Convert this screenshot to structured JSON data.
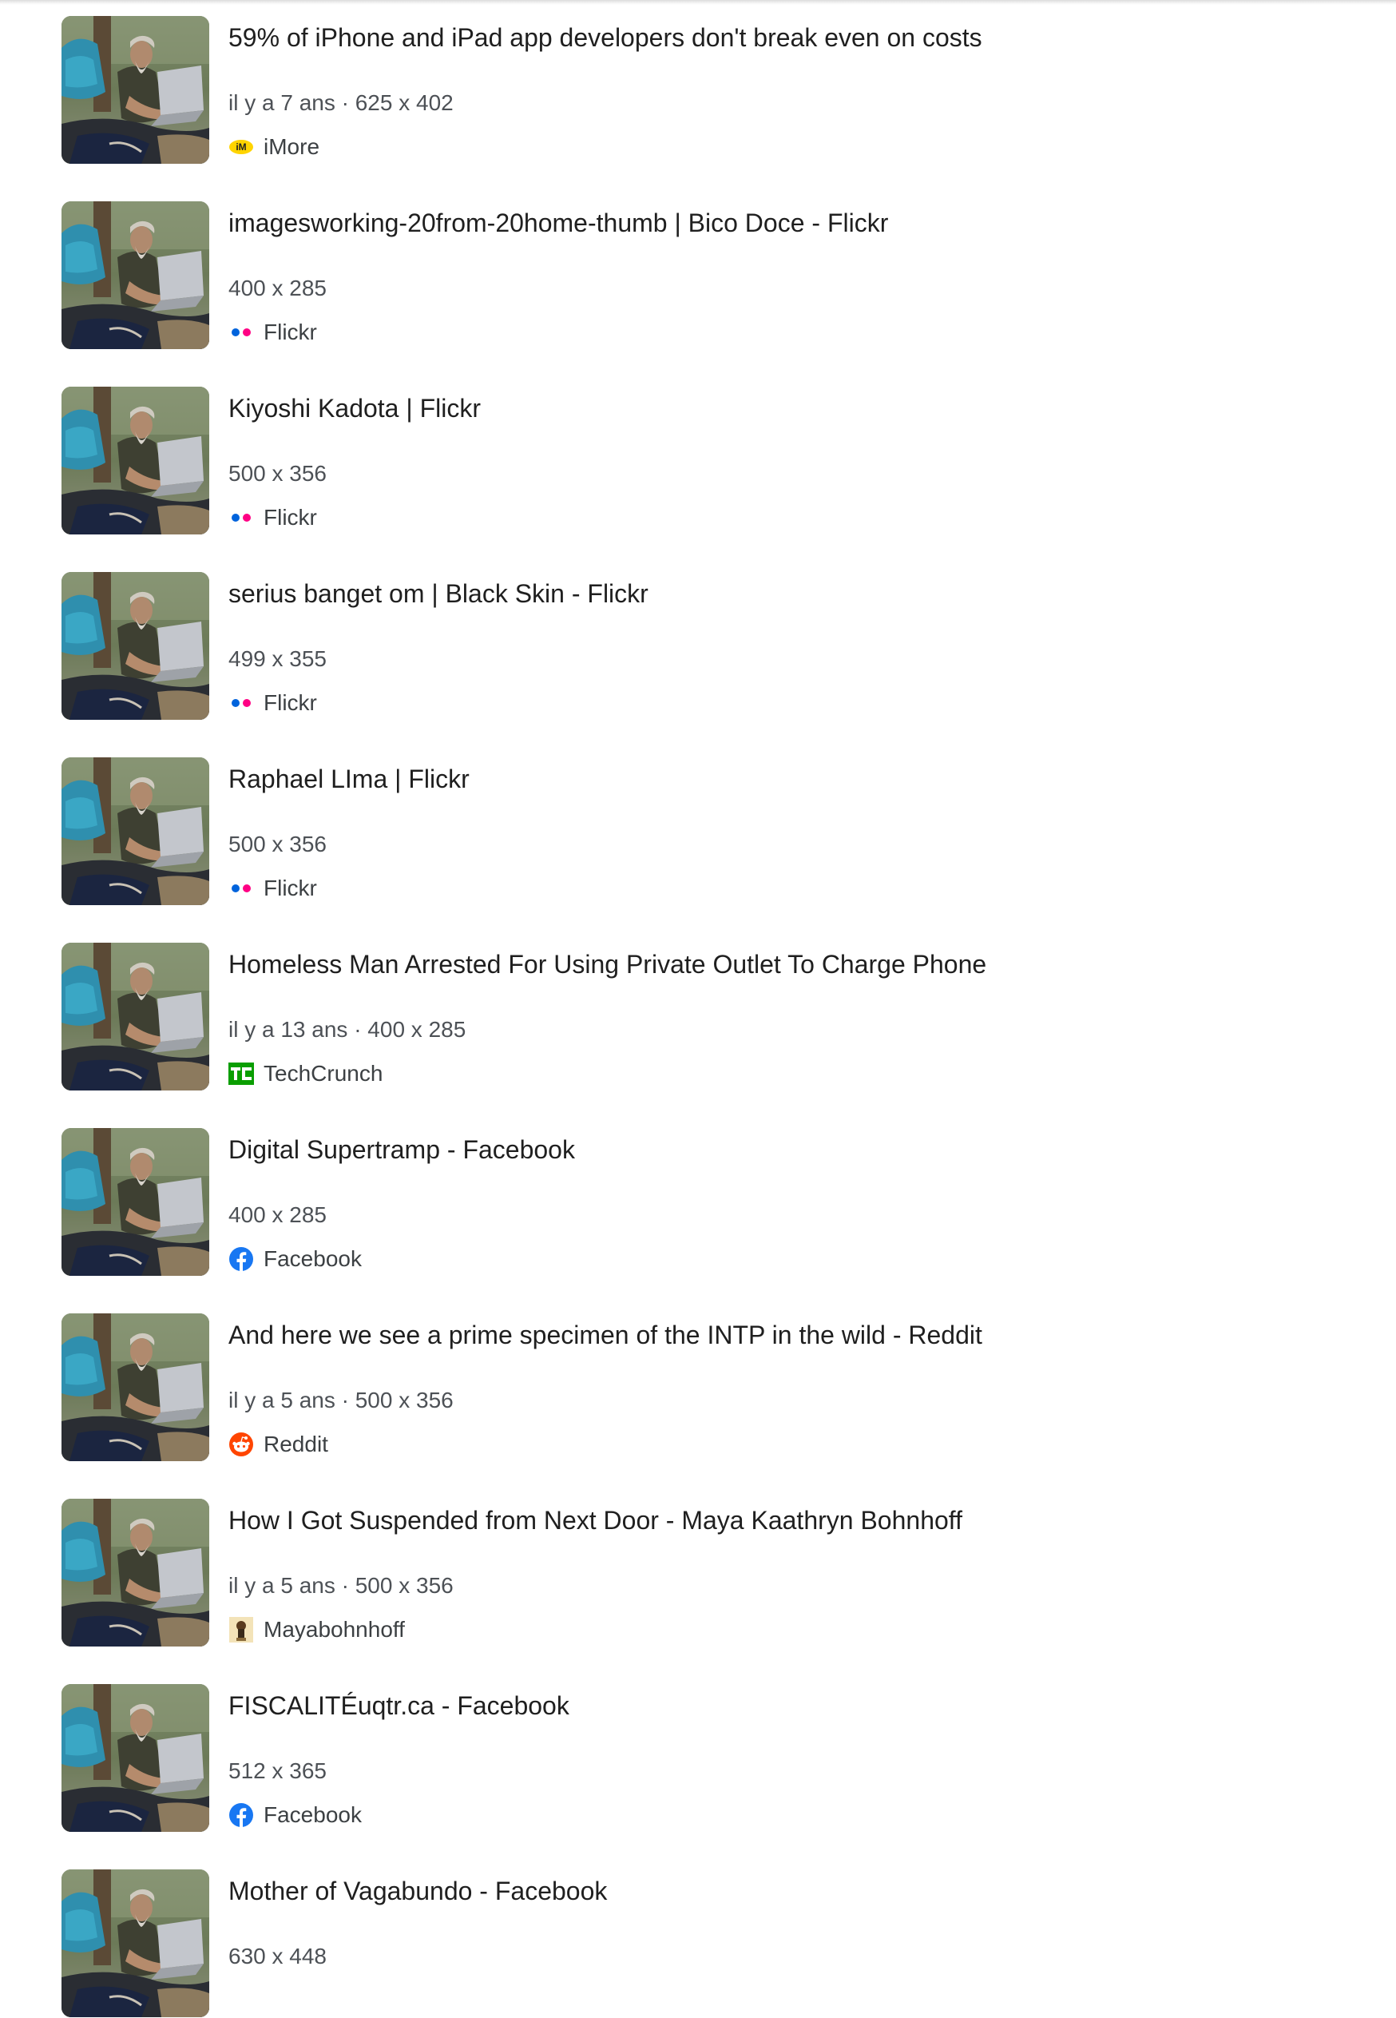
{
  "results": [
    {
      "title": "59% of iPhone and iPad app developers don't break even on costs",
      "meta": "il y a 7 ans · 625 x 402",
      "source": "iMore",
      "favicon": "imore-logo-icon"
    },
    {
      "title": "imagesworking-20from-20home-thumb | Bico Doce - Flickr",
      "meta": "400 x 285",
      "source": "Flickr",
      "favicon": "flickr-logo-icon"
    },
    {
      "title": "Kiyoshi Kadota | Flickr",
      "meta": "500 x 356",
      "source": "Flickr",
      "favicon": "flickr-logo-icon"
    },
    {
      "title": "serius banget om | Black Skin - Flickr",
      "meta": "499 x 355",
      "source": "Flickr",
      "favicon": "flickr-logo-icon"
    },
    {
      "title": "Raphael LIma | Flickr",
      "meta": "500 x 356",
      "source": "Flickr",
      "favicon": "flickr-logo-icon"
    },
    {
      "title": "Homeless Man Arrested For Using Private Outlet To Charge Phone",
      "meta": "il y a 13 ans · 400 x 285",
      "source": "TechCrunch",
      "favicon": "techcrunch-logo-icon"
    },
    {
      "title": "Digital Supertramp - Facebook",
      "meta": "400 x 285",
      "source": "Facebook",
      "favicon": "facebook-logo-icon"
    },
    {
      "title": "And here we see a prime specimen of the INTP in the wild - Reddit",
      "meta": "il y a 5 ans · 500 x 356",
      "source": "Reddit",
      "favicon": "reddit-logo-icon"
    },
    {
      "title": "How I Got Suspended from Next Door - Maya Kaathryn Bohnhoff",
      "meta": "il y a 5 ans · 500 x 356",
      "source": "Mayabohnhoff",
      "favicon": "mayabohnhoff-logo-icon"
    },
    {
      "title": "FISCALITÉuqtr.ca - Facebook",
      "meta": "512 x 365",
      "source": "Facebook",
      "favicon": "facebook-logo-icon"
    },
    {
      "title": "Mother of Vagabundo - Facebook",
      "meta": "630 x 448",
      "source": "",
      "favicon": ""
    }
  ],
  "colors": {
    "title": "#1f1f1f",
    "meta": "#4d5156",
    "flickr_blue": "#0063dc",
    "flickr_pink": "#ff0084",
    "facebook_blue": "#1877f2",
    "reddit_orange": "#ff4500",
    "techcrunch_green": "#0a9e01",
    "imore_yellow": "#ffd400"
  }
}
